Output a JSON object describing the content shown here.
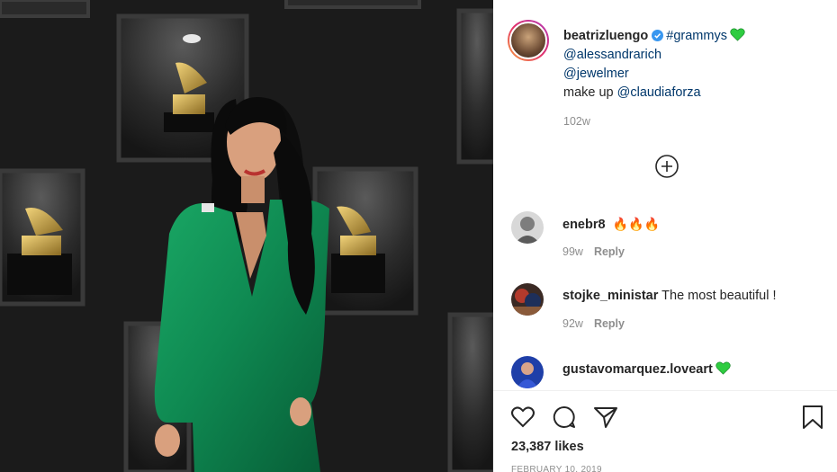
{
  "post": {
    "username": "beatrizluengo",
    "caption_lines": {
      "hashtag": "#grammys",
      "mention1": "@alessandrarich",
      "mention2": "@jewelmer",
      "makeup_prefix": "make up",
      "mention3": "@claudiaforza"
    },
    "time": "102w",
    "likes": "23,387 likes",
    "date": "FEBRUARY 10, 2019"
  },
  "comments": [
    {
      "username": "enebr8",
      "text": "",
      "emoji": "🔥🔥🔥",
      "time": "99w",
      "reply_label": "Reply"
    },
    {
      "username": "stojke_ministar",
      "text": "The most beautiful !",
      "emoji": "",
      "time": "92w",
      "reply_label": "Reply"
    },
    {
      "username": "gustavomarquez.loveart",
      "text": "",
      "emoji": "",
      "time": "",
      "reply_label": ""
    }
  ],
  "colors": {
    "link": "#00376b",
    "verified": "#3897f0",
    "heart": "#2ecc40",
    "dress": "#0f8a52",
    "muted": "#8e8e8e"
  },
  "icons": {
    "verified": "verified-badge-icon",
    "caption_heart": "green-heart-icon",
    "load_more": "plus-circle-icon",
    "like": "heart-outline-icon",
    "comment": "speech-bubble-icon",
    "share": "paper-plane-icon",
    "save": "bookmark-icon"
  }
}
